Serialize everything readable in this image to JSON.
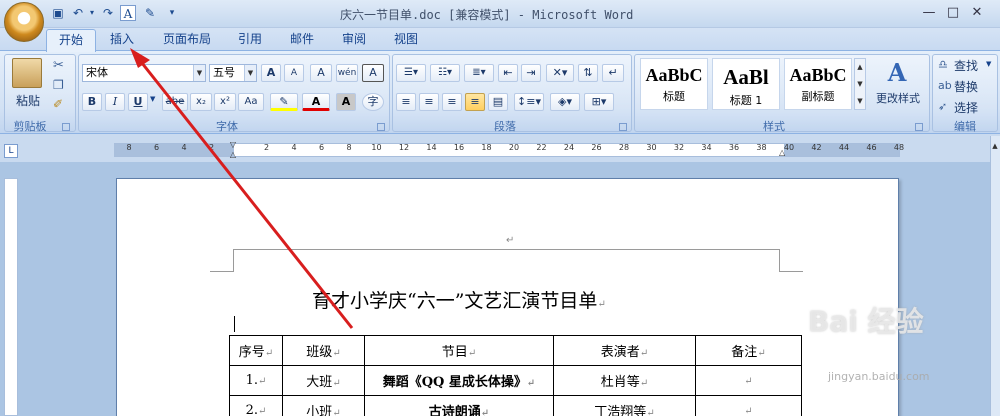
{
  "window": {
    "title": "庆六一节目单.doc [兼容模式] - Microsoft Word",
    "min": "—",
    "max": "□",
    "close": "✕"
  },
  "tabs": [
    "开始",
    "插入",
    "页面布局",
    "引用",
    "邮件",
    "审阅",
    "视图"
  ],
  "ribbon": {
    "clipboard": {
      "label": "剪贴板",
      "paste": "粘贴"
    },
    "font": {
      "label": "字体",
      "family": "宋体",
      "size": "五号",
      "grow": "A",
      "shrink": "A",
      "bold": "B",
      "italic": "I",
      "underline": "U",
      "strike": "abe",
      "subscript": "x₂",
      "superscript": "x²",
      "case": "Aa",
      "phonetic": "wén",
      "border_char": "A",
      "clear": "A",
      "char_shade": "A",
      "enclose": "字",
      "font_color": "A"
    },
    "paragraph": {
      "label": "段落"
    },
    "styles": {
      "label": "样式",
      "items": [
        {
          "sample": "AaBbC",
          "name": "标题"
        },
        {
          "sample": "AaBl",
          "name": "标题 1"
        },
        {
          "sample": "AaBbC",
          "name": "副标题"
        }
      ],
      "change": "更改样式"
    },
    "editing": {
      "label": "编辑",
      "find": "查找",
      "replace": "替换",
      "select": "选择"
    }
  },
  "ruler": {
    "numbers": [
      "8",
      "6",
      "4",
      "2",
      "2",
      "4",
      "6",
      "8",
      "10",
      "12",
      "14",
      "16",
      "18",
      "20",
      "22",
      "24",
      "26",
      "28",
      "30",
      "32",
      "34",
      "36",
      "38",
      "40",
      "42",
      "44",
      "46",
      "48"
    ],
    "tab_selector": "L"
  },
  "document": {
    "title": "育才小学庆“六一”文艺汇演节目单",
    "para_mark": "↵",
    "table": {
      "headers": [
        "序号",
        "班级",
        "节目",
        "表演者",
        "备注"
      ],
      "rows": [
        [
          "1.",
          "大班",
          "舞蹈《QQ 星成长体操》",
          "杜肖等",
          ""
        ],
        [
          "2.",
          "小班",
          "古诗朗诵",
          "丁浩翔等",
          ""
        ]
      ]
    }
  },
  "watermark": {
    "text": "Bai 经验",
    "url": "jingyan.baidu.com"
  },
  "annotation": {
    "color": "#d81e1e"
  }
}
